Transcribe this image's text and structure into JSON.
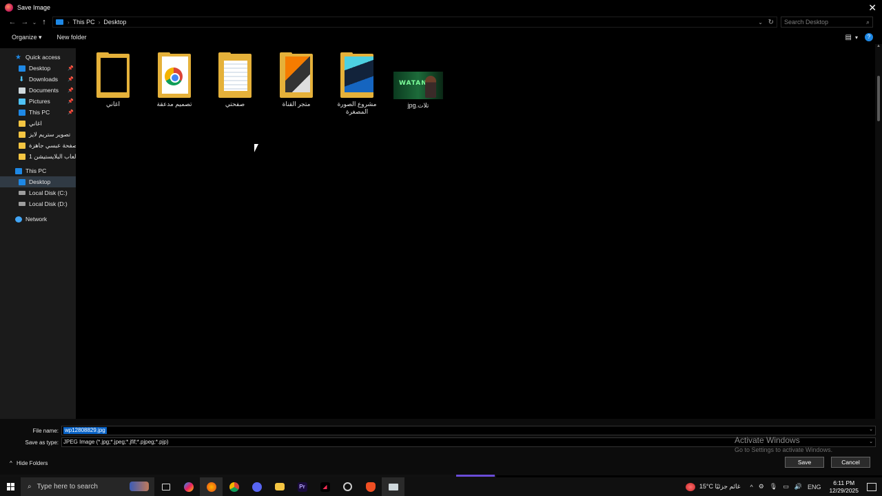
{
  "window": {
    "title": "Save Image",
    "close_glyph": "✕"
  },
  "nav": {
    "back": "←",
    "forward": "→",
    "recent": "⌄",
    "up": "↑"
  },
  "address": {
    "crumbs": [
      "This PC",
      "Desktop"
    ],
    "separator": "›"
  },
  "search": {
    "placeholder": "Search Desktop"
  },
  "toolbar": {
    "organize": "Organize ▾",
    "new_folder": "New folder",
    "help": "?"
  },
  "sidebar": {
    "items": [
      {
        "label": "Quick access",
        "icon": "star-icon"
      },
      {
        "label": "Desktop",
        "icon": "desktop-icon",
        "pinned": true
      },
      {
        "label": "Downloads",
        "icon": "downloads-icon",
        "pinned": true
      },
      {
        "label": "Documents",
        "icon": "documents-icon",
        "pinned": true
      },
      {
        "label": "Pictures",
        "icon": "pictures-icon",
        "pinned": true
      },
      {
        "label": "This PC",
        "icon": "this-pc-icon",
        "pinned": true
      },
      {
        "label": "اغاني",
        "icon": "folder-icon"
      },
      {
        "label": "تصوير ستريم لايز",
        "icon": "folder-icon"
      },
      {
        "label": "ير صفحة عبسي جاهزة",
        "icon": "folder-icon"
      },
      {
        "label": "العاب البلايستيشن 1 -",
        "icon": "folder-icon"
      },
      {
        "label": "This PC",
        "icon": "this-pc-icon"
      },
      {
        "label": "Desktop",
        "icon": "desktop-icon",
        "selected": true
      },
      {
        "label": "Local Disk (C:)",
        "icon": "disk-icon"
      },
      {
        "label": "Local Disk (D:)",
        "icon": "disk-icon"
      },
      {
        "label": "Network",
        "icon": "network-icon"
      }
    ]
  },
  "files": [
    {
      "name": "اغاني",
      "kind": "folder-black"
    },
    {
      "name": "تصميم مدعقة",
      "kind": "folder-chrome"
    },
    {
      "name": "صفحتي",
      "kind": "folder-docs"
    },
    {
      "name": "متجر القناة",
      "kind": "folder-orange"
    },
    {
      "name": "مشروع الصورة المصغرة",
      "kind": "folder-blue"
    },
    {
      "name": "تلات.jpg",
      "kind": "image",
      "thumb_text": "WATAN"
    }
  ],
  "form": {
    "file_name_label": "File name:",
    "file_name_value": "wp12808829.jpg",
    "save_type_label": "Save as type:",
    "save_type_value": "JPEG Image (*.jpg;*.jpeg;*.jfif;*.pjpeg;*.pjp)",
    "hide_folders": "Hide Folders",
    "save": "Save",
    "cancel": "Cancel"
  },
  "watermark": {
    "line1": "Activate Windows",
    "line2": "Go to Settings to activate Windows."
  },
  "taskbar": {
    "search_placeholder": "Type here to search",
    "apps": [
      "task-view",
      "copilot",
      "firefox",
      "chrome",
      "discord",
      "file-explorer",
      "premiere-pro",
      "capcut",
      "obs",
      "brave",
      "dialog-window"
    ],
    "weather": "15°C  غائم جزئيًا",
    "language": "ENG",
    "time": "6:11 PM",
    "date": "12/29/2025"
  }
}
